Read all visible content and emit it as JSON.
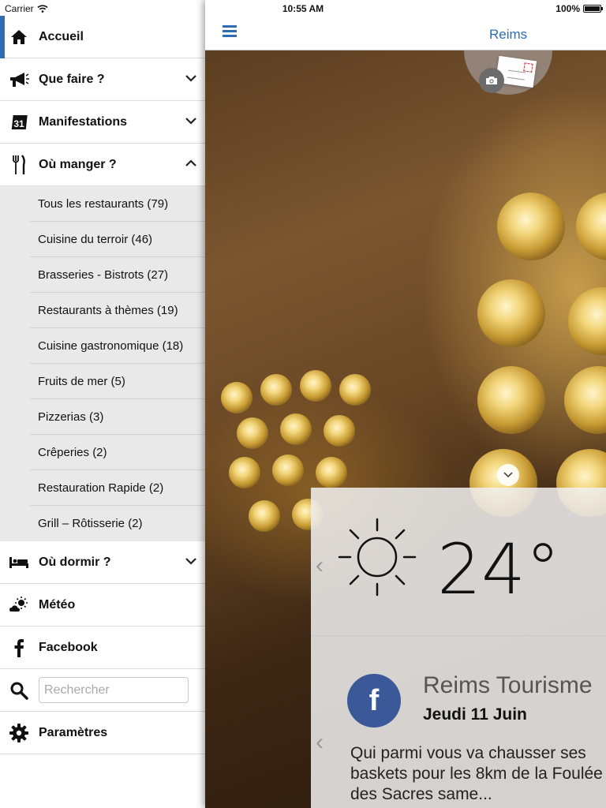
{
  "status": {
    "carrier": "Carrier",
    "time": "10:55 AM",
    "battery": "100%"
  },
  "sidebar": {
    "items": [
      {
        "label": "Accueil",
        "icon": "home-icon",
        "active": true
      },
      {
        "label": "Que faire ?",
        "icon": "megaphone-icon"
      },
      {
        "label": "Manifestations",
        "icon": "calendar-icon",
        "icon_text": "31"
      },
      {
        "label": "Où manger ?",
        "icon": "fork-knife-icon",
        "expanded": true
      }
    ],
    "submenu": [
      "Tous les restaurants (79)",
      "Cuisine du terroir (46)",
      "Brasseries - Bistrots (27)",
      "Restaurants à thèmes (19)",
      "Cuisine gastronomique (18)",
      "Fruits de mer (5)",
      "Pizzerias (3)",
      "Crêperies (2)",
      "Restauration Rapide (2)",
      "Grill – Rôtisserie (2)"
    ],
    "lower_items": [
      {
        "label": "Où dormir ?",
        "icon": "bed-icon"
      },
      {
        "label": "Météo",
        "icon": "weather-icon"
      },
      {
        "label": "Facebook",
        "icon": "facebook-icon"
      }
    ],
    "search": {
      "placeholder": "Rechercher"
    },
    "settings": {
      "label": "Paramètres",
      "icon": "gear-icon"
    }
  },
  "navbar": {
    "title": "Reims"
  },
  "weather": {
    "temperature": "24°",
    "icon": "sun-icon"
  },
  "facebook_post": {
    "name": "Reims Tourisme",
    "date": "Jeudi 11 Juin",
    "text": "Qui parmi vous va chausser ses baskets pour les 8km de la Foulée des Sacres same...",
    "icon_letter": "f"
  },
  "colors": {
    "accent": "#2e6db4",
    "facebook": "#3b5998"
  }
}
